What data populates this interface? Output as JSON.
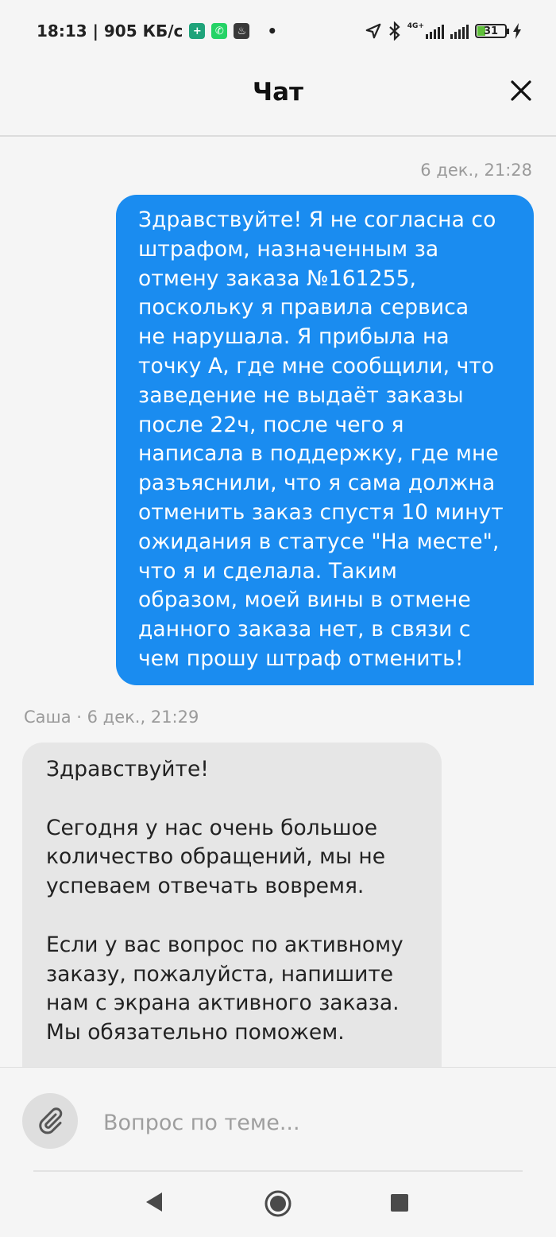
{
  "status_bar": {
    "time_speed": "18:13 | 905 КБ/с",
    "dot": "•",
    "network": "4G+",
    "battery": "31"
  },
  "header": {
    "title": "Чат"
  },
  "messages": {
    "outgoing": {
      "timestamp": "6 дек., 21:28",
      "lines": [
        "Здравствуйте! Я не согласна со",
        "штрафом, назначенным за",
        "отмену заказа №161255,",
        "поскольку я правила сервиса",
        "не нарушала. Я прибыла на",
        "точку А, где мне сообщили, что",
        "заведение не выдаёт заказы",
        "после 22ч, после чего я",
        "написала в поддержку, где мне",
        "разъяснили, что я сама должна",
        "отменить заказ спустя 10 минут",
        "ожидания в статусе \"На месте\",",
        "что я и сделала. Таким",
        "образом, моей вины в отмене",
        "данного заказа нет, в связи с",
        "чем прошу штраф отменить!"
      ]
    },
    "incoming": {
      "meta": "Саша · 6 дек., 21:29",
      "greeting": "Здравствуйте!",
      "para1": [
        "Сегодня у нас очень большое",
        "количество обращений, мы не",
        "успеваем отвечать вовремя."
      ],
      "para2": [
        "Если у вас вопрос по активному",
        "заказу, пожалуйста, напишите",
        "нам с экрана активного заказа.",
        "Мы обязательно поможем."
      ]
    }
  },
  "composer": {
    "placeholder": "Вопрос по теме..."
  },
  "colors": {
    "outgoing_bubble": "#1a8cf0",
    "incoming_bubble": "#e6e6e6",
    "background": "#f5f5f5"
  }
}
